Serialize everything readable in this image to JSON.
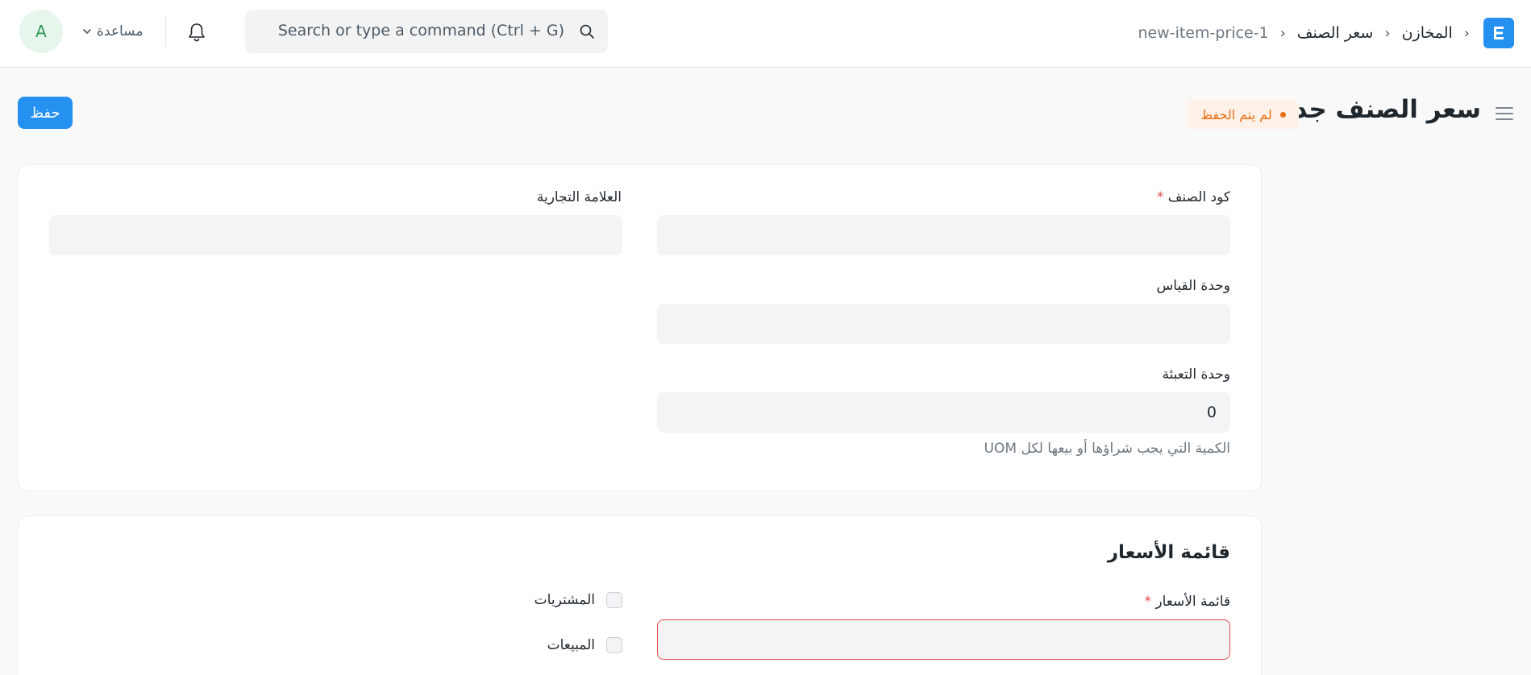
{
  "navbar": {
    "logo_letter": "E",
    "breadcrumbs": [
      "المخازن",
      "سعر الصنف",
      "new-item-price-1"
    ],
    "search_placeholder": "Search or type a command (Ctrl + G)",
    "help_label": "مساعدة",
    "avatar_initial": "A"
  },
  "page": {
    "title": "سعر الصنف جديد",
    "status": "لم يتم الحفظ",
    "save_label": "حفظ"
  },
  "form": {
    "item_code_label": "كود الصنف",
    "brand_label": "العلامة التجارية",
    "uom_label": "وحدة القياس",
    "packing_unit_label": "وحدة التعبئة",
    "packing_unit_value": "0",
    "packing_unit_hint": "الكمية التي يجب شراؤها أو بيعها لكل UOM",
    "required_mark": "*"
  },
  "price_list_section": {
    "title": "قائمة الأسعار",
    "price_list_label": "قائمة الأسعار",
    "buying_label": "المشتريات",
    "selling_label": "المبيعات"
  },
  "colors": {
    "primary": "#2490ef",
    "status_text": "#e86c13",
    "status_bg": "#fff1e7",
    "required": "#e24c4c"
  }
}
